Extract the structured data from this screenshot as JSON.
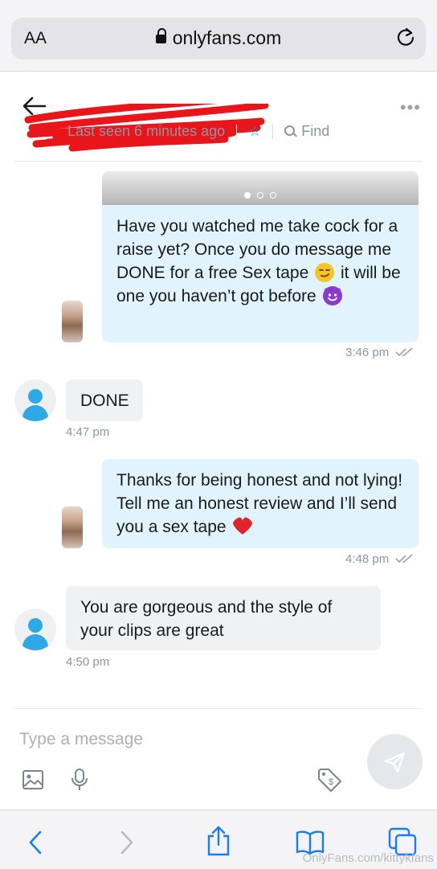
{
  "browser": {
    "text_size_label": "AA",
    "url": "onlyfans.com"
  },
  "header": {
    "last_seen": "Last seen 6 minutes ago",
    "find_label": "Find"
  },
  "messages": [
    {
      "direction": "outgoing",
      "text": "Have you watched me take cock for a raise yet? Once you do message me DONE for a free Sex tape",
      "text_after_emoji": "it will be one you haven’t got before",
      "emoji_1": "smirking-face",
      "emoji_2": "smiling-devil",
      "time": "3:46 pm",
      "media_pages": 3
    },
    {
      "direction": "incoming",
      "text": "DONE",
      "time": "4:47 pm"
    },
    {
      "direction": "outgoing",
      "text": "Thanks for being honest and not lying! Tell me an honest review and I’ll send you a sex tape",
      "emoji": "red-heart",
      "time": "4:48 pm"
    },
    {
      "direction": "incoming",
      "text": "You are gorgeous and the style of your clips are great",
      "time": "4:50 pm"
    }
  ],
  "composer": {
    "placeholder": "Type a message"
  },
  "watermark": "OnlyFans.com/kittykfans",
  "colors": {
    "accent": "#00aeef",
    "outgoing_bubble": "#e1f3fd",
    "incoming_bubble": "#f0f1f3",
    "redaction": "#e8151b"
  }
}
